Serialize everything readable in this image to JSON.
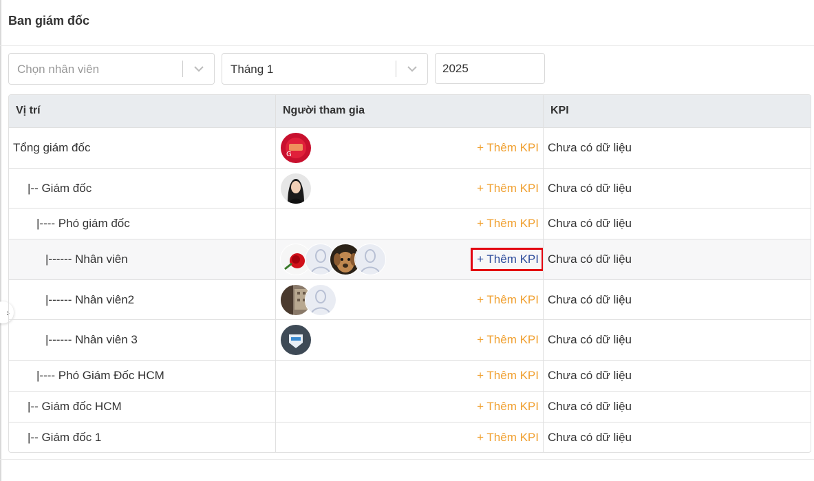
{
  "page": {
    "title": "Ban giám đốc"
  },
  "filters": {
    "employee": {
      "placeholder": "Chọn nhân viên"
    },
    "month": {
      "value": "Tháng 1"
    },
    "year": {
      "value": "2025"
    }
  },
  "table": {
    "headers": {
      "position": "Vị trí",
      "participants": "Người tham gia",
      "kpi": "KPI"
    },
    "add_kpi_label": "+ Thêm KPI",
    "rows": [
      {
        "position": "Tổng giám đốc",
        "indent": 0,
        "avatars": [
          "red-badge"
        ],
        "kpi": "Chưa có dữ liệu",
        "highlighted": false
      },
      {
        "position": "|-- Giám đốc",
        "indent": 1,
        "avatars": [
          "woman-photo"
        ],
        "kpi": "Chưa có dữ liệu",
        "highlighted": false
      },
      {
        "position": "|---- Phó giám đốc",
        "indent": 2,
        "avatars": [],
        "kpi": "Chưa có dữ liệu",
        "highlighted": false
      },
      {
        "position": "|------ Nhân viên",
        "indent": 3,
        "avatars": [
          "rose",
          "default",
          "dog",
          "default"
        ],
        "kpi": "Chưa có dữ liệu",
        "highlighted": true
      },
      {
        "position": "|------ Nhân viên2",
        "indent": 3,
        "avatars": [
          "building",
          "default"
        ],
        "kpi": "Chưa có dữ liệu",
        "highlighted": false
      },
      {
        "position": "|------ Nhân viên 3",
        "indent": 3,
        "avatars": [
          "dark-logo"
        ],
        "kpi": "Chưa có dữ liệu",
        "highlighted": false
      },
      {
        "position": "|---- Phó Giám Đốc HCM",
        "indent": 2,
        "avatars": [],
        "kpi": "Chưa có dữ liệu",
        "highlighted": false
      },
      {
        "position": "|-- Giám đốc HCM",
        "indent": 1,
        "avatars": [],
        "kpi": "Chưa có dữ liệu",
        "highlighted": false
      },
      {
        "position": "|-- Giám đốc 1",
        "indent": 1,
        "avatars": [],
        "kpi": "Chưa có dữ liệu",
        "highlighted": false
      }
    ]
  },
  "colors": {
    "accent_orange": "#f0a030",
    "active_link": "#2b4a9a",
    "highlight_border": "#e3000f"
  },
  "icons": {
    "sidebar_toggle": "chevron-right-icon",
    "select_arrow": "chevron-down-icon"
  }
}
